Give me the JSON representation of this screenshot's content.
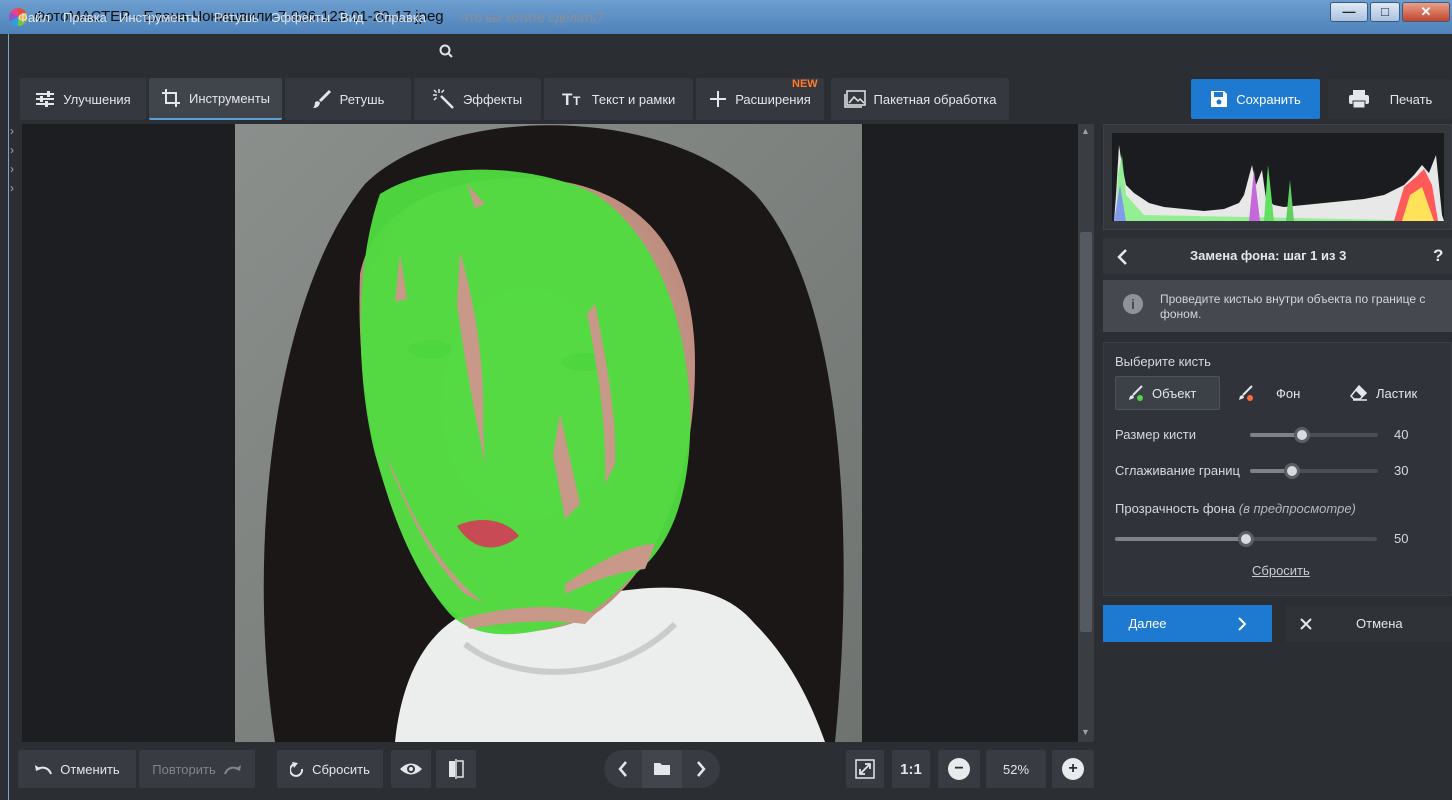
{
  "window": {
    "title": "ФотоМАСТЕР - Елена-Чонишвили-7-926-123-01-20-17.jpeg",
    "minimize": "—",
    "maximize": "□",
    "close": "✕"
  },
  "menu": {
    "items": [
      "Файл",
      "Правка",
      "Инструменты",
      "Ретушь",
      "Эффекты",
      "Вид",
      "Справка"
    ],
    "search_placeholder": "Что вы хотите сделать?"
  },
  "toolbar": {
    "tabs": [
      {
        "label": "Улучшения",
        "icon": "sliders-icon"
      },
      {
        "label": "Инструменты",
        "icon": "crop-icon",
        "active": true
      },
      {
        "label": "Ретушь",
        "icon": "brush-icon"
      },
      {
        "label": "Эффекты",
        "icon": "magic-wand-icon"
      },
      {
        "label": "Текст и рамки",
        "icon": "text-icon"
      },
      {
        "label": "Расширения",
        "icon": "plus-icon"
      }
    ],
    "new_badge": "NEW",
    "batch_label": "Пакетная обработка",
    "save_label": "Сохранить",
    "print_label": "Печать"
  },
  "panel": {
    "step_title": "Замена фона: шаг 1 из 3",
    "help": "?",
    "hint": "Проведите кистью внутри объекта по границе с фоном.",
    "choose_brush": "Выберите кисть",
    "brushes": [
      {
        "label": "Объект",
        "dot_color": "#55d64a",
        "selected": true
      },
      {
        "label": "Фон",
        "dot_color": "#ff6a3d"
      },
      {
        "label": "Ластик"
      }
    ],
    "brush_size_label": "Размер кисти",
    "brush_size_value": "40",
    "smoothing_label": "Сглаживание границ",
    "smoothing_value": "30",
    "transparency_label": "Прозрачность фона",
    "transparency_note": "(в предпросмотре)",
    "transparency_value": "50",
    "reset_label": "Сбросить",
    "next_label": "Далее",
    "cancel_label": "Отмена"
  },
  "bottombar": {
    "undo_label": "Отменить",
    "redo_label": "Повторить",
    "reset_label": "Сбросить",
    "zoom_fit": "1:1",
    "zoom_value": "52%"
  },
  "colors": {
    "accent": "#1e7ad0",
    "mask_green": "#4fdc3f",
    "new_badge": "#ff7a29"
  }
}
